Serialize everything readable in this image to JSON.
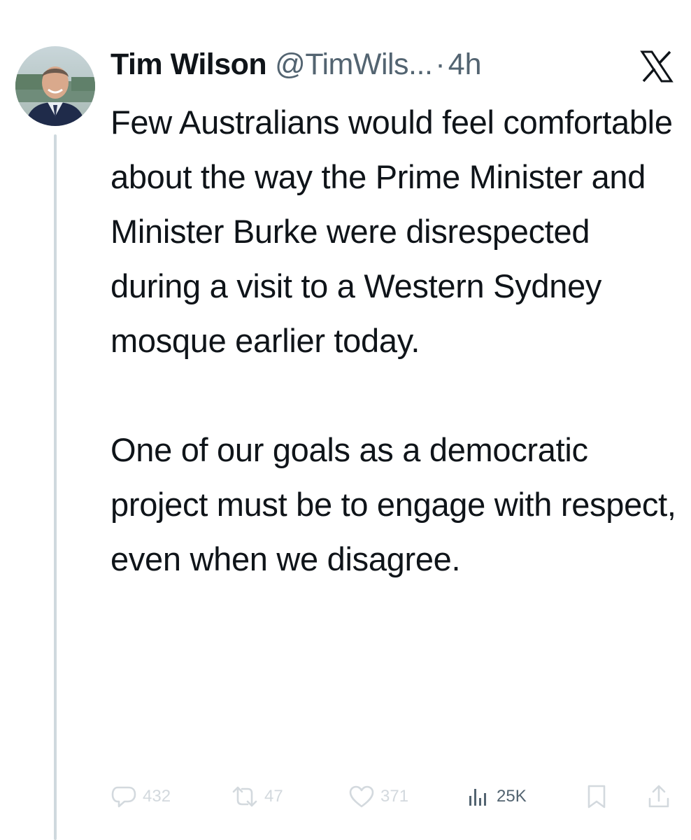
{
  "author": {
    "name": "Tim Wilson",
    "handle": "@TimWils...",
    "separator": "·",
    "time": "4h"
  },
  "tweet": {
    "paragraphs": [
      "Few Australians would feel comfortable about the way the Prime Minister and Minister Burke were disrespected during a visit to a Western Sydney mosque earlier today.",
      "One of our goals as a democratic project must be to engage with respect, even when we disagree."
    ]
  },
  "actions": {
    "replies": "432",
    "reposts": "47",
    "likes": "371",
    "views": "25K"
  },
  "icons": {
    "brand": "x-logo-icon",
    "reply": "reply-icon",
    "repost": "repost-icon",
    "like": "heart-icon",
    "views": "views-icon",
    "bookmark": "bookmark-icon",
    "share": "share-icon"
  },
  "colors": {
    "text": "#0f1419",
    "secondary": "#536471",
    "faded_action": "#d3d9de",
    "thread_line": "#cfd9de"
  }
}
